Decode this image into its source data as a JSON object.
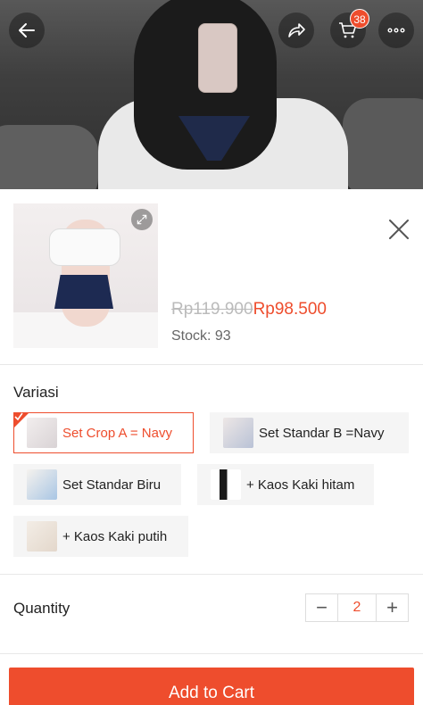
{
  "header": {
    "back_icon": "arrow-left-icon",
    "share_icon": "share-icon",
    "cart_icon": "cart-icon",
    "cart_count": "38",
    "more_icon": "more-icon"
  },
  "product": {
    "old_price": "Rp119.900",
    "new_price": "Rp98.500",
    "stock": "Stock: 93"
  },
  "variation": {
    "title": "Variasi",
    "options": [
      {
        "label": "Set Crop A = Navy",
        "selected": true
      },
      {
        "label": "Set Standar  B =Navy",
        "selected": false
      },
      {
        "label": "Set Standar Biru",
        "selected": false
      },
      {
        "label": "+ Kaos Kaki hitam",
        "selected": false
      },
      {
        "label": "+ Kaos Kaki putih",
        "selected": false
      }
    ]
  },
  "quantity": {
    "label": "Quantity",
    "value": "2",
    "minus": "−",
    "plus": "+"
  },
  "cta": {
    "label": "Add to Cart"
  },
  "colors": {
    "accent": "#ee4d2d"
  }
}
